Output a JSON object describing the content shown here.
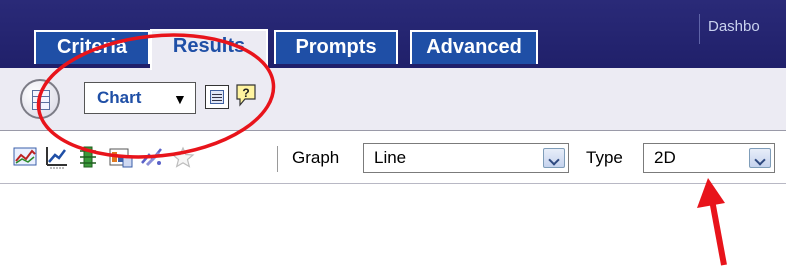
{
  "header": {
    "dashboard_link": "Dashbo"
  },
  "tabs": [
    {
      "label": "Criteria"
    },
    {
      "label": "Results"
    },
    {
      "label": "Prompts"
    },
    {
      "label": "Advanced"
    }
  ],
  "view_selector": {
    "selected": "Chart",
    "caret": "▼"
  },
  "toolbar": {
    "graph_label": "Graph",
    "graph_value": "Line",
    "type_label": "Type",
    "type_value": "2D"
  },
  "annotation": {
    "highlight_color": "#e8141b"
  }
}
